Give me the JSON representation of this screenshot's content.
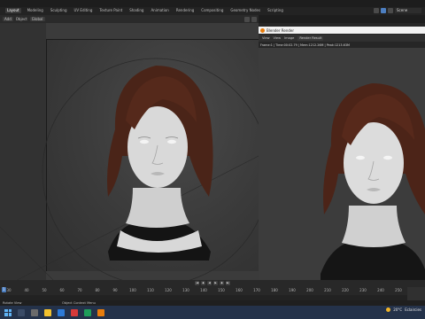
{
  "menu": {
    "workspace_tabs": [
      "Layout",
      "Modeling",
      "Sculpting",
      "UV Editing",
      "Texture Paint",
      "Shading",
      "Animation",
      "Rendering",
      "Compositing",
      "Geometry Nodes",
      "Scripting"
    ],
    "scene_label": "Scene"
  },
  "viewport_header": {
    "mode_label": "Add",
    "object_label": "Object",
    "transform_label": "Global"
  },
  "render_window": {
    "title": "Blender Render",
    "menu": [
      "View",
      "View",
      "Image"
    ],
    "slot_label": "Render Result",
    "status": "Frame:1 | Time:00:02.79 | Mem:1212.26M | Peak:1213.63M"
  },
  "timeline": {
    "current_frame": "1",
    "ticks": [
      "30",
      "40",
      "50",
      "60",
      "70",
      "80",
      "90",
      "100",
      "110",
      "120",
      "130",
      "140",
      "150",
      "160",
      "170",
      "180",
      "190",
      "200",
      "210",
      "220",
      "230",
      "240",
      "250"
    ]
  },
  "statusbar": {
    "left": "Rotate View",
    "middle": "Object Context Menu"
  },
  "taskbar": {
    "weather": "20°C",
    "weather_desc": "Eclaircies"
  },
  "colors": {
    "accent": "#4d7fc1",
    "blender_orange": "#e87d0d",
    "viewport_bg": "#3b3b3b",
    "taskbar_bg": "#24324a"
  }
}
